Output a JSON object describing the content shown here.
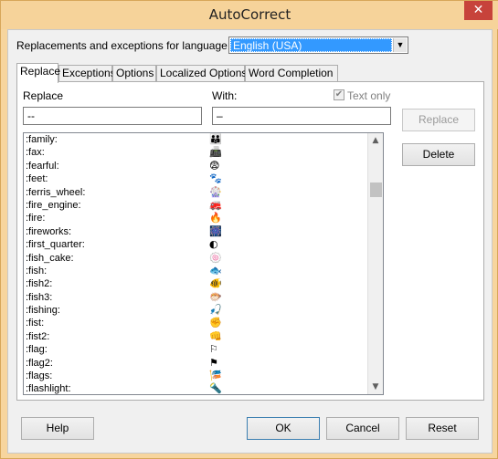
{
  "window": {
    "title": "AutoCorrect",
    "close_glyph": "✕"
  },
  "language": {
    "label": "Replacements and exceptions for language:",
    "selected": "English (USA)"
  },
  "tabs": [
    {
      "label": "Replace",
      "active": true
    },
    {
      "label": "Exceptions",
      "active": false
    },
    {
      "label": "Options",
      "active": false
    },
    {
      "label": "Localized Options",
      "active": false
    },
    {
      "label": "Word Completion",
      "active": false
    }
  ],
  "replace_tab": {
    "replace_label": "Replace",
    "with_label": "With:",
    "text_only_label": "Text only",
    "text_only_checked": true,
    "replace_value": "--",
    "with_value": "–",
    "replace_button": "Replace",
    "delete_button": "Delete",
    "entries": [
      {
        "key": ":family:",
        "value": "👪"
      },
      {
        "key": ":fax:",
        "value": "📠"
      },
      {
        "key": ":fearful:",
        "value": "😨"
      },
      {
        "key": ":feet:",
        "value": "🐾"
      },
      {
        "key": ":ferris_wheel:",
        "value": "🎡"
      },
      {
        "key": ":fire_engine:",
        "value": "🚒"
      },
      {
        "key": ":fire:",
        "value": "🔥"
      },
      {
        "key": ":fireworks:",
        "value": "🎆"
      },
      {
        "key": ":first_quarter:",
        "value": "◐"
      },
      {
        "key": ":fish_cake:",
        "value": "🍥"
      },
      {
        "key": ":fish:",
        "value": "🐟"
      },
      {
        "key": ":fish2:",
        "value": "🐠"
      },
      {
        "key": ":fish3:",
        "value": "🐡"
      },
      {
        "key": ":fishing:",
        "value": "🎣"
      },
      {
        "key": ":fist:",
        "value": "✊"
      },
      {
        "key": ":fist2:",
        "value": "👊"
      },
      {
        "key": ":flag:",
        "value": "⚐"
      },
      {
        "key": ":flag2:",
        "value": "⚑"
      },
      {
        "key": ":flags:",
        "value": "🎏"
      },
      {
        "key": ":flashlight:",
        "value": "🔦"
      }
    ]
  },
  "footer": {
    "help": "Help",
    "ok": "OK",
    "cancel": "Cancel",
    "reset": "Reset"
  }
}
